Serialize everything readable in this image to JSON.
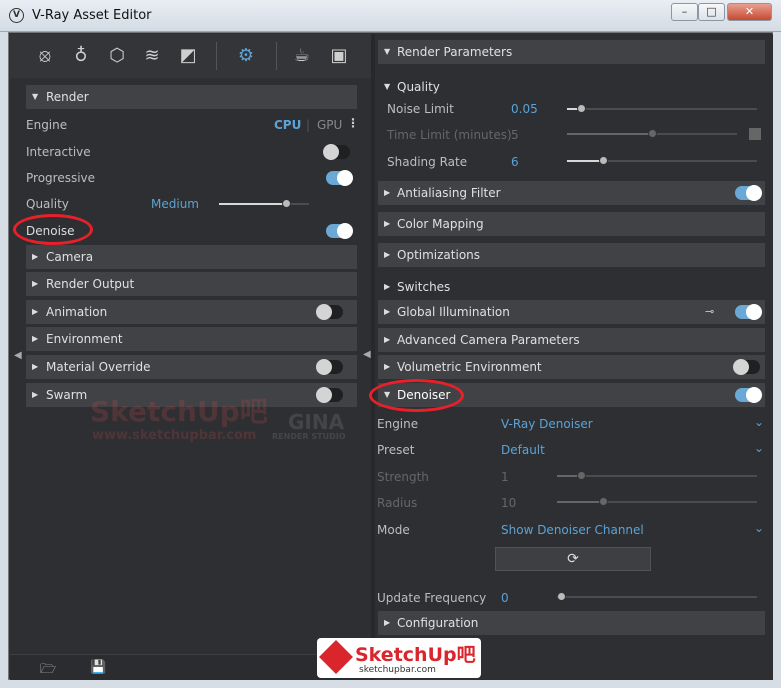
{
  "window": {
    "title": "V-Ray Asset Editor",
    "app_icon": "vray-logo-icon"
  },
  "colors": {
    "accent": "#5ba3d6",
    "highlight": "#e8202a",
    "panel": "#2d2f32",
    "header": "#404246"
  },
  "left": {
    "render_header": "Render",
    "engine": {
      "label": "Engine",
      "cpu": "CPU",
      "gpu": "GPU"
    },
    "interactive": {
      "label": "Interactive",
      "on": false
    },
    "progressive": {
      "label": "Progressive",
      "on": true
    },
    "quality": {
      "label": "Quality",
      "value": "Medium",
      "level": 0.75
    },
    "denoise": {
      "label": "Denoise",
      "on": true
    },
    "sections": [
      {
        "label": "Camera"
      },
      {
        "label": "Render Output"
      },
      {
        "label": "Animation",
        "on": false
      },
      {
        "label": "Environment"
      },
      {
        "label": "Material Override",
        "on": false
      },
      {
        "label": "Swarm",
        "on": false
      }
    ],
    "watermark": {
      "brand": "SketchUp吧",
      "url": "www.sketchupbar.com",
      "studio": "GINA",
      "studio_sub": "RENDER STUDIO"
    }
  },
  "right": {
    "render_params": "Render Parameters",
    "quality_header": "Quality",
    "noise_limit": {
      "label": "Noise Limit",
      "value": "0.05",
      "level": 0.08
    },
    "time_limit": {
      "label": "Time Limit (minutes)",
      "value": "5",
      "level": 0.5
    },
    "shading_rate": {
      "label": "Shading Rate",
      "value": "6",
      "level": 0.2
    },
    "sections": [
      {
        "label": "Antialiasing Filter",
        "on": true
      },
      {
        "label": "Color Mapping"
      },
      {
        "label": "Optimizations"
      },
      {
        "label": "Switches"
      },
      {
        "label": "Global Illumination",
        "on": true
      },
      {
        "label": "Advanced Camera Parameters"
      },
      {
        "label": "Volumetric Environment",
        "on": false
      }
    ],
    "denoiser": {
      "header": "Denoiser",
      "on": true,
      "engine": {
        "label": "Engine",
        "value": "V-Ray Denoiser"
      },
      "preset": {
        "label": "Preset",
        "value": "Default"
      },
      "strength": {
        "label": "Strength",
        "value": "1",
        "level": 0.12
      },
      "radius": {
        "label": "Radius",
        "value": "10",
        "level": 0.23
      },
      "mode": {
        "label": "Mode",
        "value": "Show Denoiser Channel"
      }
    },
    "update_frequency": {
      "label": "Update Frequency",
      "value": "0",
      "level": 0.0
    },
    "configuration": "Configuration",
    "watermark": {
      "brand": "SketchUp吧",
      "url": "sketchupbar.com"
    }
  }
}
